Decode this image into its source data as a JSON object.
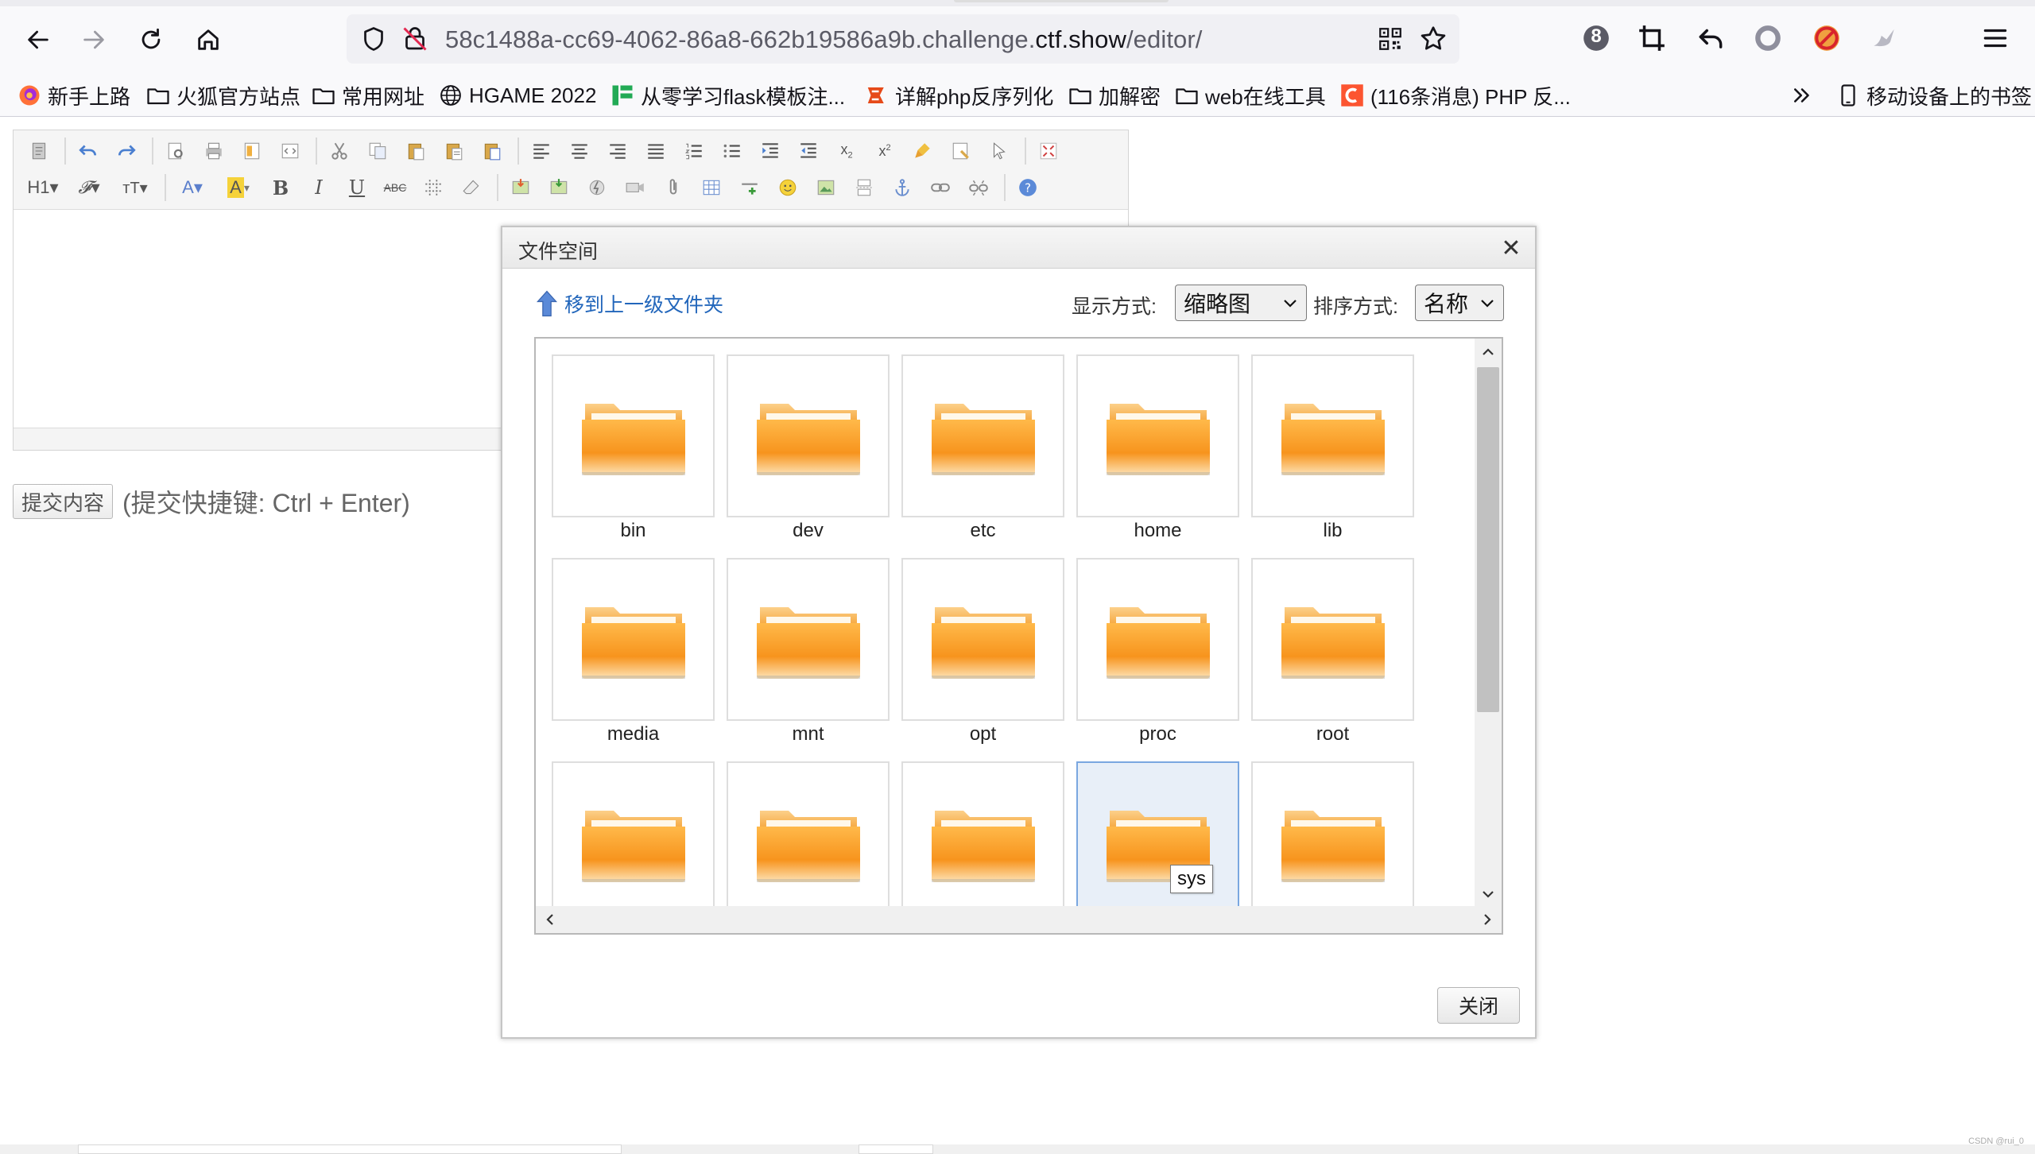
{
  "browser": {
    "url_prefix": "58c1488a-cc69-4062-86a8-662b19586a9b.challenge.",
    "url_domain": "ctf.show",
    "url_path": "/editor/",
    "extensions_badge": "8",
    "bookmarks": [
      {
        "label": "新手上路",
        "icon": "firefox-icon"
      },
      {
        "label": "火狐官方站点",
        "icon": "folder-icon"
      },
      {
        "label": "常用网址",
        "icon": "folder-icon"
      },
      {
        "label": "HGAME 2022",
        "icon": "globe-icon"
      },
      {
        "label": "从零学习flask模板注...",
        "icon": "site-icon"
      },
      {
        "label": "详解php反序列化",
        "icon": "site-icon"
      },
      {
        "label": "加解密",
        "icon": "folder-icon"
      },
      {
        "label": "web在线工具",
        "icon": "folder-icon"
      },
      {
        "label": "(116条消息) PHP 反...",
        "icon": "csdn-icon"
      }
    ],
    "mobile_bookmarks": "移动设备上的书签"
  },
  "editor": {
    "submit_label": "提交内容",
    "submit_hint": "(提交快捷键: Ctrl + Enter)"
  },
  "dialog": {
    "title": "文件空间",
    "up_folder_label": "移到上一级文件夹",
    "view_label": "显示方式:",
    "view_value": "缩略图",
    "sort_label": "排序方式:",
    "sort_value": "名称",
    "close_button": "关闭",
    "tooltip": "sys",
    "folders": [
      "bin",
      "dev",
      "etc",
      "home",
      "lib",
      "media",
      "mnt",
      "opt",
      "proc",
      "root",
      "",
      "",
      "",
      "",
      ""
    ]
  },
  "watermark": "CSDN @rui_0"
}
